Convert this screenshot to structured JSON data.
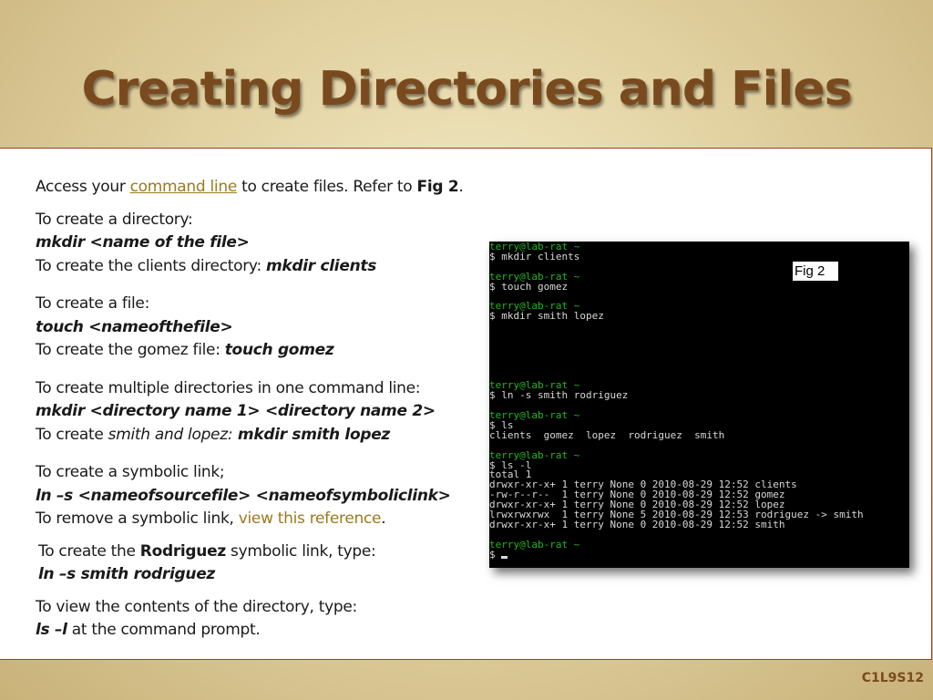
{
  "slide": {
    "title": "Creating Directories and Files",
    "slide_number": "C1L9S12"
  },
  "content": {
    "intro_pre": "Access your ",
    "intro_link": "command line",
    "intro_mid": " to create files. Refer to ",
    "intro_fig": "Fig 2",
    "intro_end": ".",
    "dir_heading": "To create a directory:",
    "dir_syntax": "mkdir <name of the file>",
    "dir_example_pre": "To create the clients directory: ",
    "dir_example_cmd": "mkdir clients",
    "file_heading": "To create a file:",
    "file_syntax": "touch <nameofthefile>",
    "file_example_pre": "To create the gomez file: ",
    "file_example_cmd": "touch gomez",
    "multi_heading": "To create multiple directories in one command line:",
    "multi_syntax": "mkdir  <directory name 1> <directory name 2>",
    "multi_example_pre": "To create ",
    "multi_example_it": "smith and lopez:",
    "multi_example_cmd": " mkdir smith lopez",
    "link_heading": "To create a symbolic link;",
    "link_syntax": "ln –s <nameofsourcefile> <nameofsymboliclink>",
    "link_remove_pre": "To remove a symbolic link, ",
    "link_remove_link": "view this reference",
    "link_remove_end": ".",
    "rod_pre": "To create the ",
    "rod_bold": "Rodriguez",
    "rod_post": " symbolic link, type:",
    "rod_cmd": "ln –s smith rodriguez",
    "view_heading": "To view the contents of the directory, type:",
    "view_cmd": "ls –l",
    "view_post": " at the command prompt."
  },
  "terminal": {
    "fig_label": "Fig 2",
    "lines": [
      {
        "type": "prompt",
        "text": "terry@lab-rat ~"
      },
      {
        "type": "out",
        "text": "$ mkdir clients"
      },
      {
        "type": "blank",
        "text": ""
      },
      {
        "type": "prompt",
        "text": "terry@lab-rat ~"
      },
      {
        "type": "out",
        "text": "$ touch gomez"
      },
      {
        "type": "blank",
        "text": ""
      },
      {
        "type": "prompt",
        "text": "terry@lab-rat ~"
      },
      {
        "type": "out",
        "text": "$ mkdir smith lopez"
      },
      {
        "type": "blank",
        "text": ""
      },
      {
        "type": "blank",
        "text": ""
      },
      {
        "type": "blank",
        "text": ""
      },
      {
        "type": "blank",
        "text": ""
      },
      {
        "type": "blank",
        "text": ""
      },
      {
        "type": "blank",
        "text": ""
      },
      {
        "type": "prompt",
        "text": "terry@lab-rat ~"
      },
      {
        "type": "out",
        "text": "$ ln -s smith rodriguez"
      },
      {
        "type": "blank",
        "text": ""
      },
      {
        "type": "prompt",
        "text": "terry@lab-rat ~"
      },
      {
        "type": "out",
        "text": "$ ls"
      },
      {
        "type": "out",
        "text": "clients  gomez  lopez  rodriguez  smith"
      },
      {
        "type": "blank",
        "text": ""
      },
      {
        "type": "prompt",
        "text": "terry@lab-rat ~"
      },
      {
        "type": "out",
        "text": "$ ls -l"
      },
      {
        "type": "out",
        "text": "total 1"
      },
      {
        "type": "out",
        "text": "drwxr-xr-x+ 1 terry None 0 2010-08-29 12:52 clients"
      },
      {
        "type": "out",
        "text": "-rw-r--r--  1 terry None 0 2010-08-29 12:52 gomez"
      },
      {
        "type": "out",
        "text": "drwxr-xr-x+ 1 terry None 0 2010-08-29 12:52 lopez"
      },
      {
        "type": "out",
        "text": "lrwxrwxrwx  1 terry None 5 2010-08-29 12:53 rodriguez -> smith"
      },
      {
        "type": "out",
        "text": "drwxr-xr-x+ 1 terry None 0 2010-08-29 12:52 smith"
      },
      {
        "type": "blank",
        "text": ""
      },
      {
        "type": "prompt",
        "text": "terry@lab-rat ~"
      },
      {
        "type": "out",
        "text": "$ "
      }
    ]
  }
}
